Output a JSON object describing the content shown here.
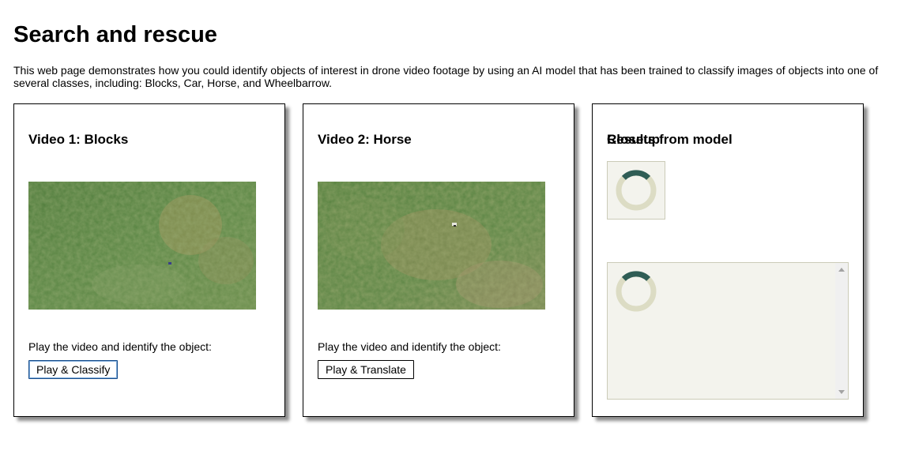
{
  "page": {
    "title": "Search and rescue",
    "intro": "This web page demonstrates how you could identify objects of interest in drone video footage by using an AI model that has been trained to classify images of objects into one of several classes, including: Blocks, Car, Horse, and Wheelbarrow."
  },
  "video1": {
    "title": "Video 1: Blocks",
    "play_label": "Play the video and identify the object:",
    "button_label": "Play & Classify"
  },
  "video2": {
    "title": "Video 2: Horse",
    "play_label": "Play the video and identify the object:",
    "button_label": "Play & Translate"
  },
  "closeup": {
    "title": "Closeup",
    "results_title": "Results from model"
  },
  "colors": {
    "spinner_track": "#dcdcc4",
    "spinner_arc": "#2f5d55",
    "box_background": "#f3f3ed",
    "grass": "#5e8a45"
  }
}
